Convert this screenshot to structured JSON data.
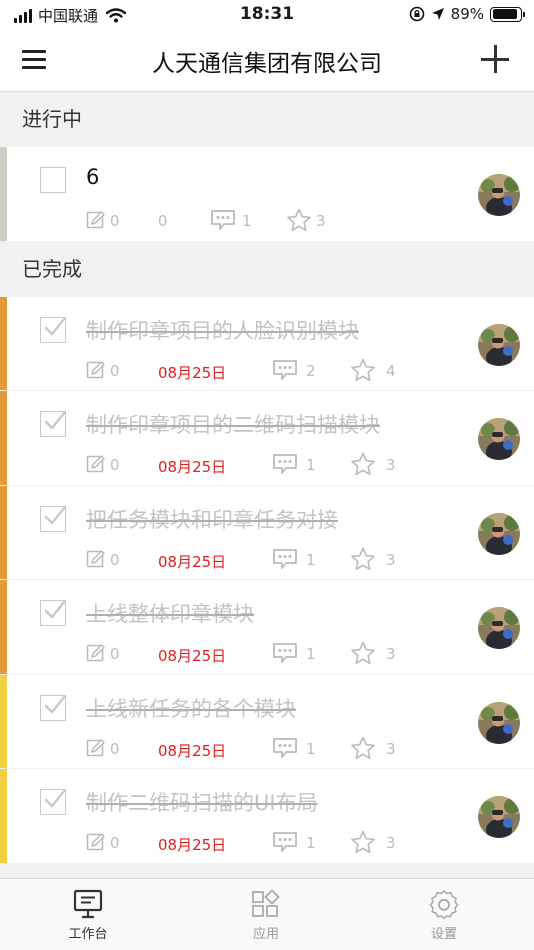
{
  "status_bar": {
    "carrier": "中国联通",
    "time": "18:31",
    "battery": "89%",
    "battery_level": 0.89,
    "icons": [
      "signal-icon",
      "wifi-icon",
      "orientation-lock-icon",
      "location-arrow-icon",
      "battery-icon"
    ]
  },
  "nav": {
    "title": "人天通信集团有限公司",
    "menu_icon": "hamburger-menu-icon",
    "add_icon": "plus-icon"
  },
  "sections": {
    "in_progress": "进行中",
    "completed": "已完成"
  },
  "in_progress_tasks": [
    {
      "title": "6",
      "edits": "0",
      "extra": "0",
      "comments": "1",
      "stars": "3",
      "bar_color": "#cfcfc7"
    }
  ],
  "completed_tasks": [
    {
      "title": "制作印章项目的人脸识别模块",
      "edits": "0",
      "date": "08月25日",
      "comments": "2",
      "stars": "4",
      "bar_color": "#e59a3a"
    },
    {
      "title": "制作印章项目的二维码扫描模块",
      "edits": "0",
      "date": "08月25日",
      "comments": "1",
      "stars": "3",
      "bar_color": "#e59a3a"
    },
    {
      "title": "把任务模块和印章任务对接",
      "edits": "0",
      "date": "08月25日",
      "comments": "1",
      "stars": "3",
      "bar_color": "#e59a3a"
    },
    {
      "title": "上线整体印章模块",
      "edits": "0",
      "date": "08月25日",
      "comments": "1",
      "stars": "3",
      "bar_color": "#e59a3a"
    },
    {
      "title": "上线新任务的各个模块",
      "edits": "0",
      "date": "08月25日",
      "comments": "1",
      "stars": "3",
      "bar_color": "#f0cf40"
    },
    {
      "title": "制作二维码扫描的UI布局",
      "edits": "0",
      "date": "08月25日",
      "comments": "1",
      "stars": "3",
      "bar_color": "#f0cf40"
    }
  ],
  "tabs": [
    {
      "label": "工作台",
      "icon": "monitor-icon",
      "active": true
    },
    {
      "label": "应用",
      "icon": "apps-grid-icon",
      "active": false
    },
    {
      "label": "设置",
      "icon": "settings-gear-icon",
      "active": false
    }
  ],
  "colors": {
    "date_red": "#e02020",
    "section_bg": "#f2f2f2",
    "orange_bar": "#e59a3a",
    "yellow_bar": "#f0cf40"
  }
}
